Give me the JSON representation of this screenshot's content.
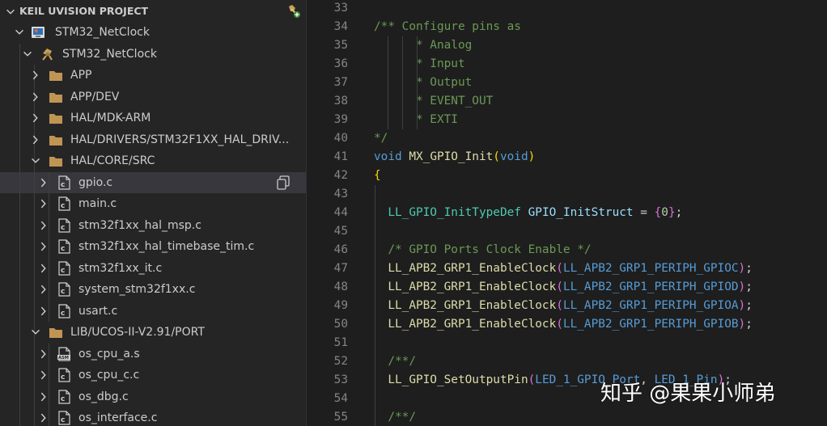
{
  "sidebar": {
    "header": {
      "title": "KEIL UVISION PROJECT"
    },
    "items": [
      {
        "label": "STM32_NetClock",
        "level": 0,
        "expanded": true,
        "icon": "project-icon"
      },
      {
        "label": "STM32_NetClock",
        "level": 1,
        "expanded": true,
        "icon": "target-icon"
      },
      {
        "label": "APP",
        "level": 2,
        "expanded": false,
        "icon": "folder-icon"
      },
      {
        "label": "APP/DEV",
        "level": 2,
        "expanded": false,
        "icon": "folder-icon"
      },
      {
        "label": "HAL/MDK-ARM",
        "level": 2,
        "expanded": false,
        "icon": "folder-icon"
      },
      {
        "label": "HAL/DRIVERS/STM32F1XX_HAL_DRIV...",
        "level": 2,
        "expanded": false,
        "icon": "folder-icon"
      },
      {
        "label": "HAL/CORE/SRC",
        "level": 2,
        "expanded": true,
        "icon": "folder-icon"
      },
      {
        "label": "gpio.c",
        "level": 3,
        "expanded": false,
        "icon": "c-file-icon",
        "selected": true
      },
      {
        "label": "main.c",
        "level": 3,
        "expanded": false,
        "icon": "c-file-icon"
      },
      {
        "label": "stm32f1xx_hal_msp.c",
        "level": 3,
        "expanded": false,
        "icon": "c-file-icon"
      },
      {
        "label": "stm32f1xx_hal_timebase_tim.c",
        "level": 3,
        "expanded": false,
        "icon": "c-file-icon"
      },
      {
        "label": "stm32f1xx_it.c",
        "level": 3,
        "expanded": false,
        "icon": "c-file-icon"
      },
      {
        "label": "system_stm32f1xx.c",
        "level": 3,
        "expanded": false,
        "icon": "c-file-icon"
      },
      {
        "label": "usart.c",
        "level": 3,
        "expanded": false,
        "icon": "c-file-icon"
      },
      {
        "label": "LIB/UCOS-II-V2.91/PORT",
        "level": 2,
        "expanded": true,
        "icon": "folder-icon"
      },
      {
        "label": "os_cpu_a.s",
        "level": 3,
        "expanded": false,
        "icon": "asm-file-icon"
      },
      {
        "label": "os_cpu_c.c",
        "level": 3,
        "expanded": false,
        "icon": "c-file-icon"
      },
      {
        "label": "os_dbg.c",
        "level": 3,
        "expanded": false,
        "icon": "c-file-icon"
      },
      {
        "label": "os_interface.c",
        "level": 3,
        "expanded": false,
        "icon": "c-file-icon"
      }
    ]
  },
  "editor": {
    "lines": [
      {
        "n": "33",
        "tokens": []
      },
      {
        "n": "34",
        "tokens": [
          {
            "t": "/** Configure pins as",
            "c": "c-comment"
          }
        ]
      },
      {
        "n": "35",
        "tokens": [
          {
            "t": "      * Analog",
            "c": "c-comment"
          }
        ]
      },
      {
        "n": "36",
        "tokens": [
          {
            "t": "      * Input",
            "c": "c-comment"
          }
        ]
      },
      {
        "n": "37",
        "tokens": [
          {
            "t": "      * Output",
            "c": "c-comment"
          }
        ]
      },
      {
        "n": "38",
        "tokens": [
          {
            "t": "      * EVENT_OUT",
            "c": "c-comment"
          }
        ]
      },
      {
        "n": "39",
        "tokens": [
          {
            "t": "      * EXTI",
            "c": "c-comment"
          }
        ]
      },
      {
        "n": "40",
        "tokens": [
          {
            "t": "*/",
            "c": "c-comment"
          }
        ]
      },
      {
        "n": "41",
        "tokens": [
          {
            "t": "void",
            "c": "c-kw"
          },
          {
            "t": " ",
            "c": "c-punct"
          },
          {
            "t": "MX_GPIO_Init",
            "c": "c-fn"
          },
          {
            "t": "(",
            "c": "c-paren"
          },
          {
            "t": "void",
            "c": "c-kw"
          },
          {
            "t": ")",
            "c": "c-paren"
          }
        ]
      },
      {
        "n": "42",
        "tokens": [
          {
            "t": "{",
            "c": "c-paren"
          }
        ]
      },
      {
        "n": "43",
        "tokens": []
      },
      {
        "n": "44",
        "tokens": [
          {
            "t": "  LL_GPIO_InitTypeDef",
            "c": "c-type"
          },
          {
            "t": " ",
            "c": "c-punct"
          },
          {
            "t": "GPIO_InitStruct",
            "c": "c-var"
          },
          {
            "t": " = ",
            "c": "c-punct"
          },
          {
            "t": "{",
            "c": "c-brace"
          },
          {
            "t": "0",
            "c": "c-num"
          },
          {
            "t": "}",
            "c": "c-brace"
          },
          {
            "t": ";",
            "c": "c-punct"
          }
        ]
      },
      {
        "n": "45",
        "tokens": []
      },
      {
        "n": "46",
        "tokens": [
          {
            "t": "  /* GPIO Ports Clock Enable */",
            "c": "c-comment"
          }
        ]
      },
      {
        "n": "47",
        "tokens": [
          {
            "t": "  LL_APB2_GRP1_EnableClock",
            "c": "c-fn"
          },
          {
            "t": "(",
            "c": "c-brace"
          },
          {
            "t": "LL_APB2_GRP1_PERIPH_GPIOC",
            "c": "c-kw"
          },
          {
            "t": ")",
            "c": "c-brace"
          },
          {
            "t": ";",
            "c": "c-punct"
          }
        ]
      },
      {
        "n": "48",
        "tokens": [
          {
            "t": "  LL_APB2_GRP1_EnableClock",
            "c": "c-fn"
          },
          {
            "t": "(",
            "c": "c-brace"
          },
          {
            "t": "LL_APB2_GRP1_PERIPH_GPIOD",
            "c": "c-kw"
          },
          {
            "t": ")",
            "c": "c-brace"
          },
          {
            "t": ";",
            "c": "c-punct"
          }
        ]
      },
      {
        "n": "49",
        "tokens": [
          {
            "t": "  LL_APB2_GRP1_EnableClock",
            "c": "c-fn"
          },
          {
            "t": "(",
            "c": "c-brace"
          },
          {
            "t": "LL_APB2_GRP1_PERIPH_GPIOA",
            "c": "c-kw"
          },
          {
            "t": ")",
            "c": "c-brace"
          },
          {
            "t": ";",
            "c": "c-punct"
          }
        ]
      },
      {
        "n": "50",
        "tokens": [
          {
            "t": "  LL_APB2_GRP1_EnableClock",
            "c": "c-fn"
          },
          {
            "t": "(",
            "c": "c-brace"
          },
          {
            "t": "LL_APB2_GRP1_PERIPH_GPIOB",
            "c": "c-kw"
          },
          {
            "t": ")",
            "c": "c-brace"
          },
          {
            "t": ";",
            "c": "c-punct"
          }
        ]
      },
      {
        "n": "51",
        "tokens": []
      },
      {
        "n": "52",
        "tokens": [
          {
            "t": "  /**/",
            "c": "c-comment"
          }
        ]
      },
      {
        "n": "53",
        "tokens": [
          {
            "t": "  LL_GPIO_SetOutputPin",
            "c": "c-fn"
          },
          {
            "t": "(",
            "c": "c-brace"
          },
          {
            "t": "LED_1_GPIO_Port",
            "c": "c-kw"
          },
          {
            "t": ", ",
            "c": "c-punct"
          },
          {
            "t": "LED_1_Pin",
            "c": "c-kw"
          },
          {
            "t": ")",
            "c": "c-brace"
          },
          {
            "t": ";",
            "c": "c-punct"
          }
        ]
      },
      {
        "n": "54",
        "tokens": []
      },
      {
        "n": "55",
        "tokens": [
          {
            "t": "  /**/",
            "c": "c-comment"
          }
        ]
      }
    ]
  },
  "watermark": {
    "text": "知乎 @果果小师弟"
  },
  "colors": {
    "sidebar_bg": "#252526",
    "editor_bg": "#1e1e1e",
    "selected_row": "#37373d",
    "folder": "#c09553"
  }
}
